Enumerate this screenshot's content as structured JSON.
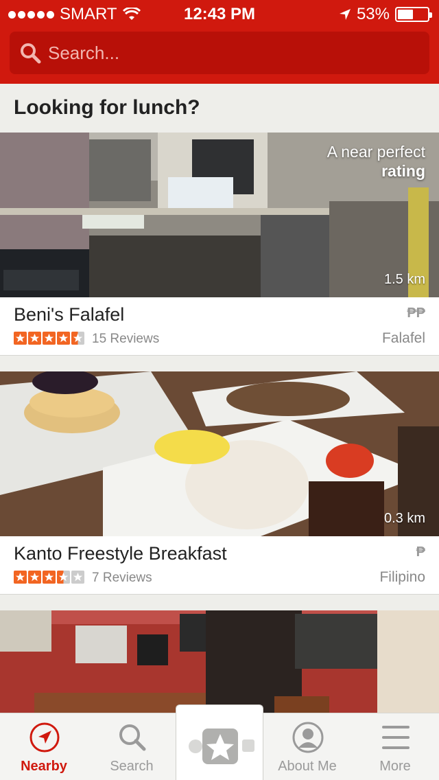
{
  "status_bar": {
    "carrier": "SMART",
    "time": "12:43 PM",
    "battery": "53%",
    "battery_level": 0.53
  },
  "search": {
    "placeholder": "Search..."
  },
  "section_title": "Looking for lunch?",
  "cards": [
    {
      "name": "Beni's Falafel",
      "rating": 4.5,
      "reviews": "15 Reviews",
      "price": "₱₱",
      "category": "Falafel",
      "distance": "1.5 km",
      "badge_line1": "A near perfect",
      "badge_line2": "rating"
    },
    {
      "name": "Kanto Freestyle Breakfast",
      "rating": 3.5,
      "reviews": "7 Reviews",
      "price": "₱",
      "category": "Filipino",
      "distance": "0.3 km"
    }
  ],
  "tabs": [
    {
      "label": "Nearby",
      "icon": "navigation-arrow-icon",
      "active": true
    },
    {
      "label": "Search",
      "icon": "search-icon"
    },
    {
      "label": "",
      "icon": "star-icon"
    },
    {
      "label": "About Me",
      "icon": "profile-icon"
    },
    {
      "label": "More",
      "icon": "menu-icon"
    }
  ],
  "colors": {
    "brand_red": "#d0190e",
    "star_orange": "#f26522",
    "inactive_gray": "#9a9a9a"
  }
}
